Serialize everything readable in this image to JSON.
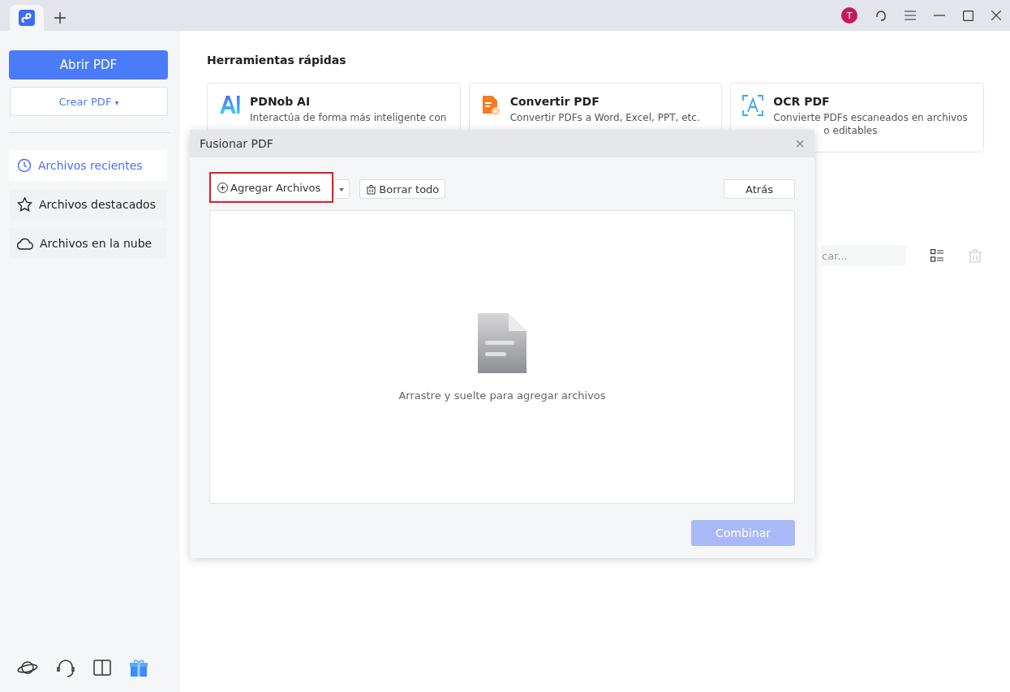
{
  "topbar": {
    "avatar": "T"
  },
  "sidebar": {
    "primary_button": "Abrir PDF",
    "secondary_button": "Crear PDF",
    "secondary_caret": "▾",
    "items": [
      {
        "label": "Archivos recientes",
        "kind": "clock",
        "selected": true
      },
      {
        "label": "Archivos destacados",
        "kind": "star",
        "selected": false
      },
      {
        "label": "Archivos en la nube",
        "kind": "cloud",
        "selected": false
      }
    ]
  },
  "main": {
    "title": "Herramientas rápidas",
    "tools": [
      {
        "kind": "ai",
        "title": "PDNob AI",
        "lines": [
          "Interactúa de forma más inteligente con"
        ]
      },
      {
        "kind": "convert",
        "title": "Convertir PDF",
        "lines": [
          "Convertir PDFs a Word, Excel, PPT, etc."
        ]
      },
      {
        "kind": "ocr",
        "title": "OCR PDF",
        "lines": [
          "Convierte PDFs escaneados en archivos",
          "o editables"
        ]
      }
    ],
    "search": {
      "placeholder": "car..."
    }
  },
  "dialog": {
    "title": "Fusionar PDF",
    "close": "×",
    "add_button": {
      "label": "Agregar Archivos",
      "highlighted": true
    },
    "clear_button": "Borrar todo",
    "back_button": "Atrás",
    "drop_hint": "Arrastre y suelte para agregar archivos",
    "combine_button": {
      "label": "Combinar",
      "disabled": true
    }
  }
}
